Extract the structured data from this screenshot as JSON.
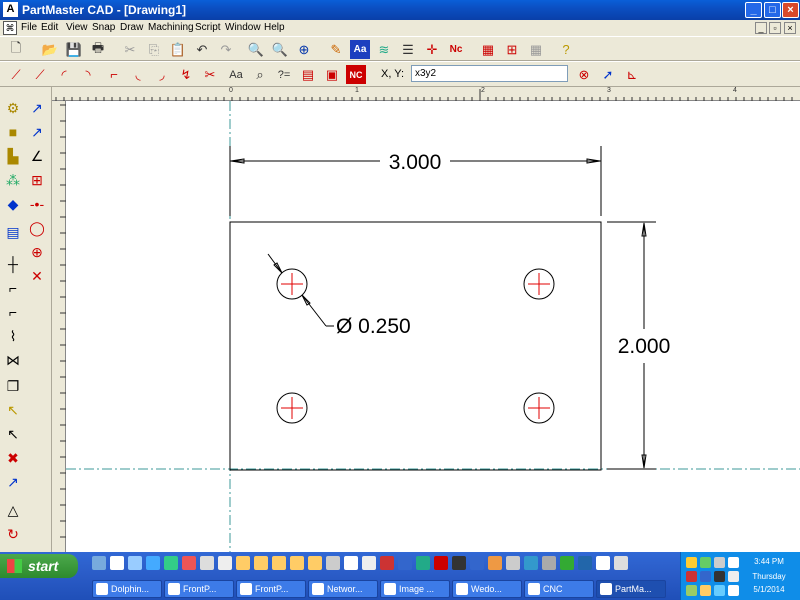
{
  "window": {
    "title": "PartMaster CAD - [Drawing1]"
  },
  "menu": [
    "File",
    "Edit",
    "View",
    "Snap",
    "Draw",
    "Machining",
    "Script",
    "Window",
    "Help"
  ],
  "coord": {
    "label": "X, Y:",
    "value": "x3y2"
  },
  "drawing": {
    "width_label": "3.000",
    "height_label": "2.000",
    "hole_label": "Ø 0.250",
    "line_color": "#000000",
    "center_color": "#e00000",
    "construction_color": "#3c9a9a"
  },
  "ruler": {
    "marks": [
      "0",
      "1",
      "2",
      "3",
      "4"
    ]
  },
  "taskbar": {
    "start_label": "start",
    "tasks": [
      "Dolphin...",
      "FrontP...",
      "FrontP...",
      "Networ...",
      "Image ...",
      "Wedo...",
      "CNC",
      "PartMa..."
    ],
    "time": "3:44 PM",
    "day": "Thursday",
    "date": "5/1/2014"
  }
}
